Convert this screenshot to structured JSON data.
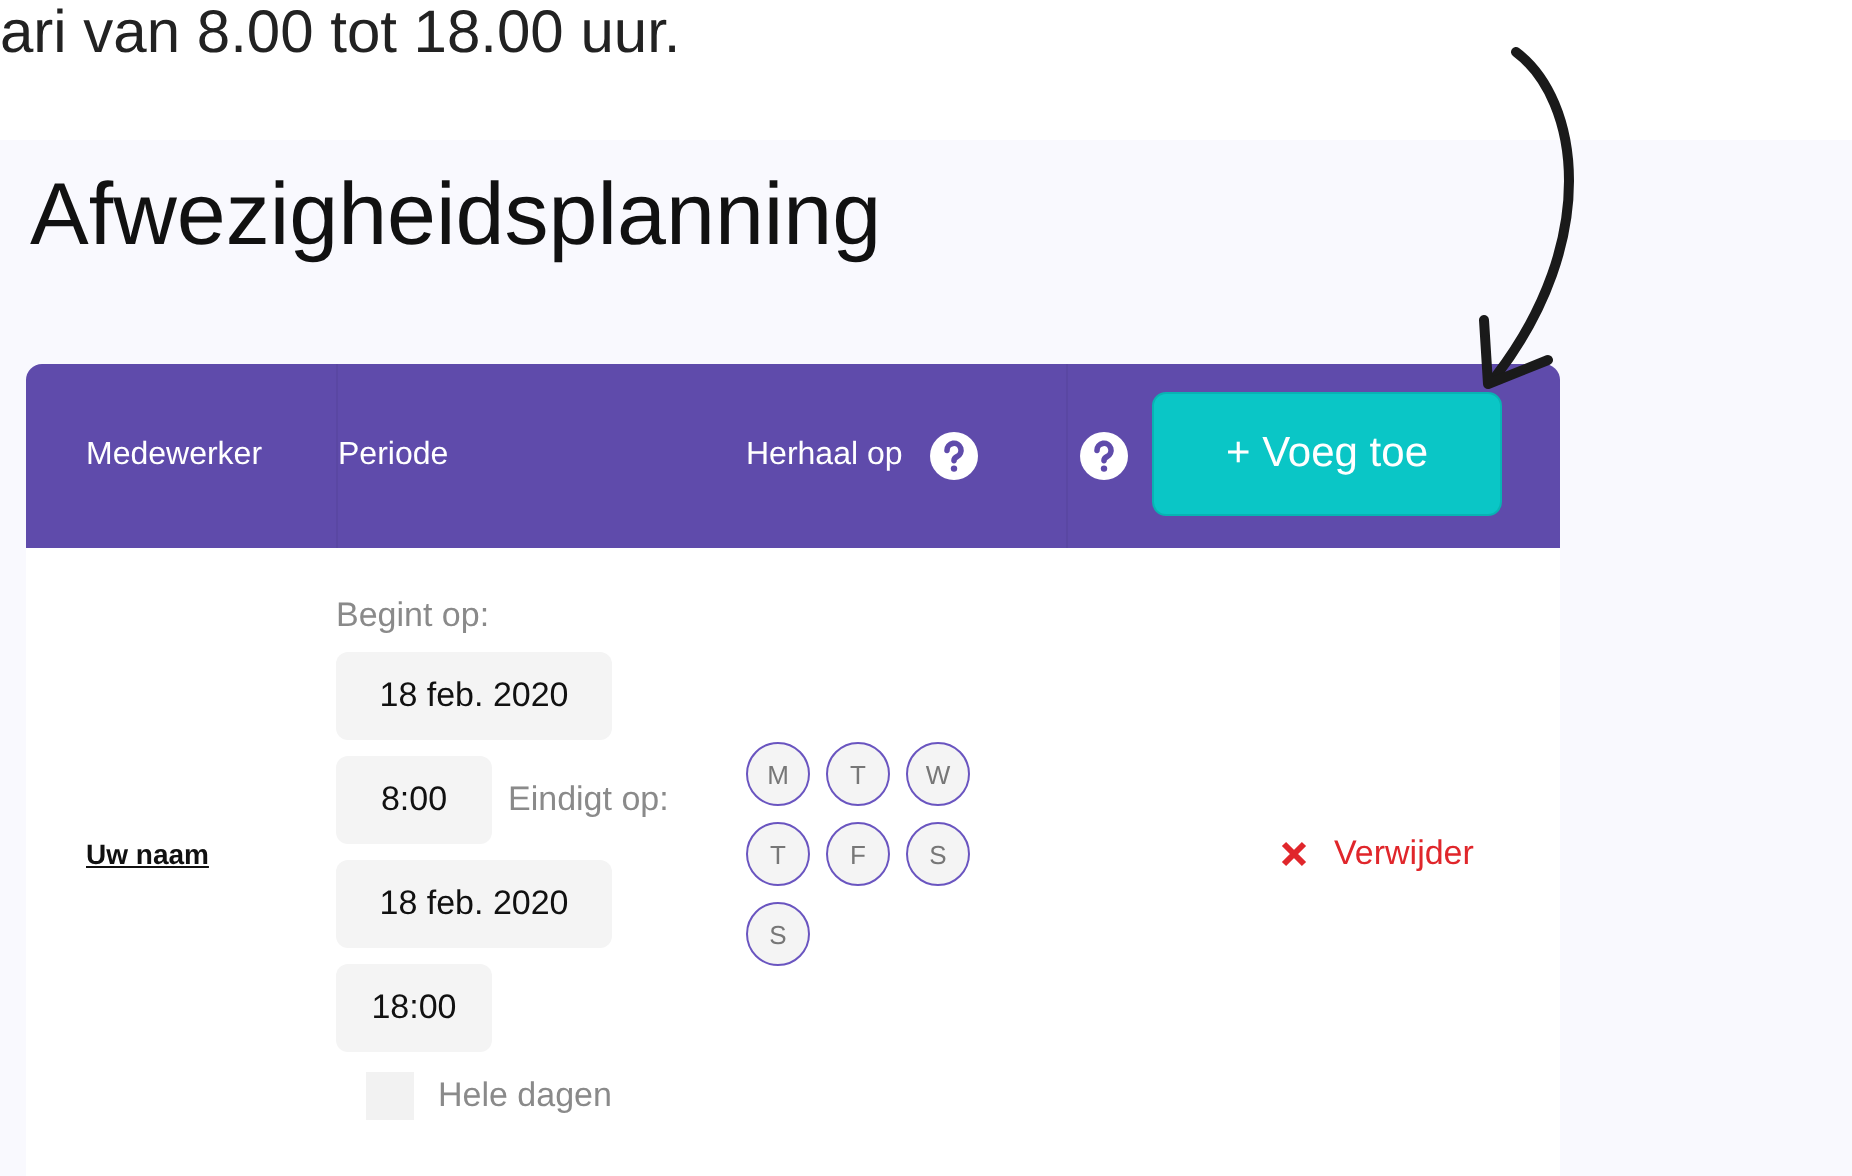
{
  "intro_text": "ari van 8.00 tot 18.00 uur.",
  "title": "Afwezigheidsplanning",
  "table": {
    "columns": [
      {
        "label": "Medewerker",
        "help": false
      },
      {
        "label": "Periode",
        "help": false
      },
      {
        "label": "Herhaal op",
        "help": true
      }
    ],
    "actions": {
      "help": true,
      "add_button": "+ Voeg toe"
    },
    "rows": [
      {
        "employee": "Uw naam",
        "start_label": "Begint op:",
        "start_date": "18 feb. 2020",
        "start_time": "8:00",
        "end_label": "Eindigt op:",
        "end_date": "18 feb. 2020",
        "end_time": "18:00",
        "all_day": {
          "label": "Hele dagen",
          "checked": false
        },
        "days": [
          {
            "label": "M",
            "selected": false
          },
          {
            "label": "T",
            "selected": false
          },
          {
            "label": "W",
            "selected": false
          },
          {
            "label": "T",
            "selected": false
          },
          {
            "label": "F",
            "selected": false
          },
          {
            "label": "S",
            "selected": false
          },
          {
            "label": "S",
            "selected": false
          }
        ],
        "delete": "Verwijder"
      }
    ]
  }
}
